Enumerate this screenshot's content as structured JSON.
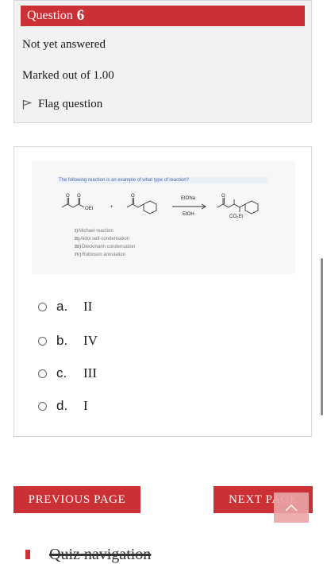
{
  "question": {
    "label": "Question",
    "number": "6",
    "status": "Not yet answered",
    "marks": "Marked out of 1.00",
    "flag_label": "Flag question"
  },
  "reaction": {
    "prompt": "The following reaction is an example of what type of reaction?",
    "reagent_top": "EtONa",
    "reagent_bottom": "EtOH",
    "ester_label": "OEt",
    "product_label": "CO₂Et",
    "choices": [
      {
        "roman": "I)",
        "text": "Michael reaction"
      },
      {
        "roman": "II)",
        "text": "Aldol self-condensation"
      },
      {
        "roman": "III)",
        "text": "Dieckmann condensation"
      },
      {
        "roman": "IV)",
        "text": "Robinson annulation"
      }
    ]
  },
  "answers": [
    {
      "letter": "a.",
      "value": "II"
    },
    {
      "letter": "b.",
      "value": "IV"
    },
    {
      "letter": "c.",
      "value": "III"
    },
    {
      "letter": "d.",
      "value": "I"
    }
  ],
  "nav": {
    "prev": "PREVIOUS PAGE",
    "next": "NEXT PAGE",
    "quiz_nav": "Quiz navigation"
  },
  "colors": {
    "accent": "#cb3034"
  }
}
